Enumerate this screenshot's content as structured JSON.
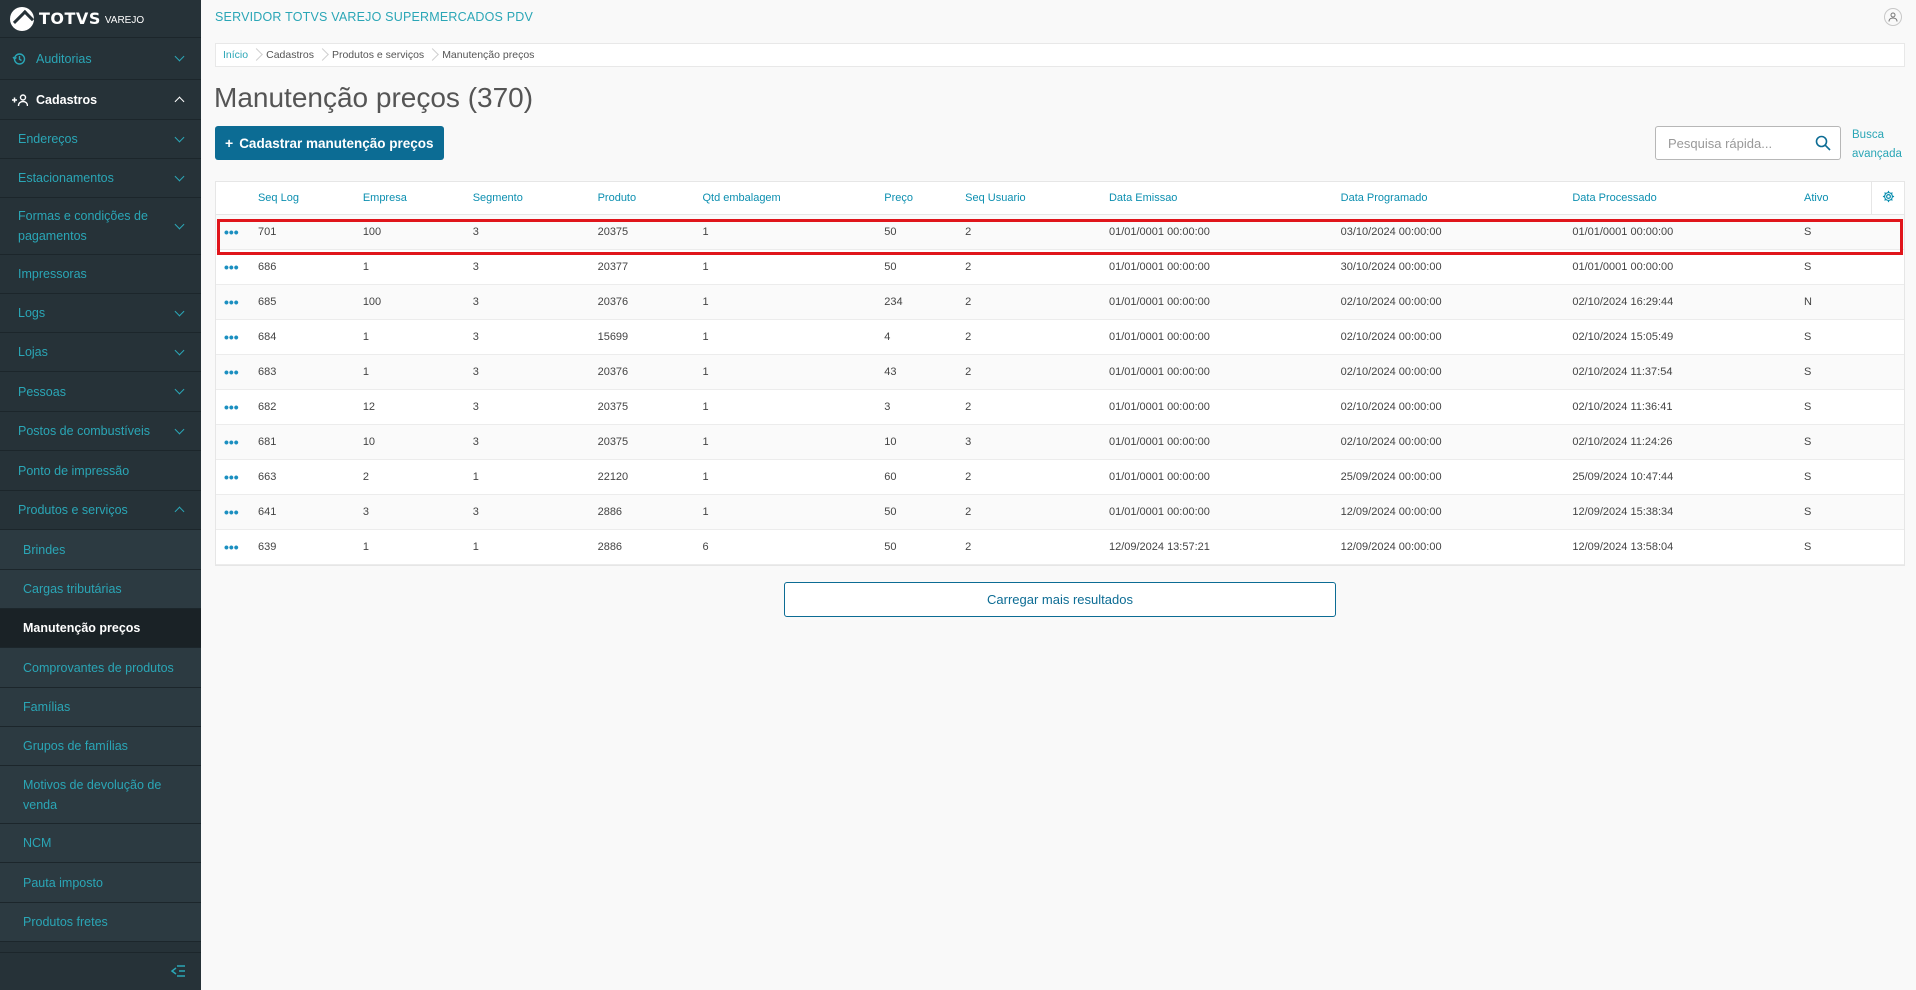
{
  "app": {
    "logo_text": "TOTVS",
    "logo_sub": "VAREJO",
    "server_title": "SERVIDOR TOTVS VAREJO SUPERMERCADOS PDV"
  },
  "sidebar": {
    "auditorias": "Auditorias",
    "cadastros": "Cadastros",
    "enderecos": "Endereços",
    "estacionamentos": "Estacionamentos",
    "formas": "Formas e condições de pagamentos",
    "impressoras": "Impressoras",
    "logs": "Logs",
    "lojas": "Lojas",
    "pessoas": "Pessoas",
    "postos": "Postos de combustíveis",
    "ponto": "Ponto de impressão",
    "produtos": "Produtos e serviços",
    "brindes": "Brindes",
    "cargas": "Cargas tributárias",
    "manutencao": "Manutenção preços",
    "comprovantes": "Comprovantes de produtos",
    "familias": "Famílias",
    "grupos": "Grupos de famílias",
    "motivos": "Motivos de devolução de venda",
    "ncm": "NCM",
    "pauta": "Pauta imposto",
    "fretes": "Produtos fretes"
  },
  "breadcrumb": {
    "inicio": "Início",
    "cadastros": "Cadastros",
    "produtos": "Produtos e serviços",
    "current": "Manutenção preços"
  },
  "page": {
    "title": "Manutenção preços (370)",
    "add_button": "Cadastrar manutenção preços",
    "search_placeholder": "Pesquisa rápida...",
    "advanced_search": "Busca avançada",
    "load_more": "Carregar mais resultados"
  },
  "table": {
    "headers": {
      "seq_log": "Seq Log",
      "empresa": "Empresa",
      "segmento": "Segmento",
      "produto": "Produto",
      "qtd": "Qtd embalagem",
      "preco": "Preço",
      "seq_usuario": "Seq Usuario",
      "data_emissao": "Data Emissao",
      "data_programado": "Data Programado",
      "data_processado": "Data Processado",
      "ativo": "Ativo"
    },
    "rows": [
      {
        "seq": "701",
        "empresa": "100",
        "segmento": "3",
        "produto": "20375",
        "qtd": "1",
        "preco": "50",
        "usuario": "2",
        "emissao": "01/01/0001 00:00:00",
        "programado": "03/10/2024 00:00:00",
        "processado": "01/01/0001 00:00:00",
        "ativo": "S"
      },
      {
        "seq": "686",
        "empresa": "1",
        "segmento": "3",
        "produto": "20377",
        "qtd": "1",
        "preco": "50",
        "usuario": "2",
        "emissao": "01/01/0001 00:00:00",
        "programado": "30/10/2024 00:00:00",
        "processado": "01/01/0001 00:00:00",
        "ativo": "S"
      },
      {
        "seq": "685",
        "empresa": "100",
        "segmento": "3",
        "produto": "20376",
        "qtd": "1",
        "preco": "234",
        "usuario": "2",
        "emissao": "01/01/0001 00:00:00",
        "programado": "02/10/2024 00:00:00",
        "processado": "02/10/2024 16:29:44",
        "ativo": "N"
      },
      {
        "seq": "684",
        "empresa": "1",
        "segmento": "3",
        "produto": "15699",
        "qtd": "1",
        "preco": "4",
        "usuario": "2",
        "emissao": "01/01/0001 00:00:00",
        "programado": "02/10/2024 00:00:00",
        "processado": "02/10/2024 15:05:49",
        "ativo": "S"
      },
      {
        "seq": "683",
        "empresa": "1",
        "segmento": "3",
        "produto": "20376",
        "qtd": "1",
        "preco": "43",
        "usuario": "2",
        "emissao": "01/01/0001 00:00:00",
        "programado": "02/10/2024 00:00:00",
        "processado": "02/10/2024 11:37:54",
        "ativo": "S"
      },
      {
        "seq": "682",
        "empresa": "12",
        "segmento": "3",
        "produto": "20375",
        "qtd": "1",
        "preco": "3",
        "usuario": "2",
        "emissao": "01/01/0001 00:00:00",
        "programado": "02/10/2024 00:00:00",
        "processado": "02/10/2024 11:36:41",
        "ativo": "S"
      },
      {
        "seq": "681",
        "empresa": "10",
        "segmento": "3",
        "produto": "20375",
        "qtd": "1",
        "preco": "10",
        "usuario": "3",
        "emissao": "01/01/0001 00:00:00",
        "programado": "02/10/2024 00:00:00",
        "processado": "02/10/2024 11:24:26",
        "ativo": "S"
      },
      {
        "seq": "663",
        "empresa": "2",
        "segmento": "1",
        "produto": "22120",
        "qtd": "1",
        "preco": "60",
        "usuario": "2",
        "emissao": "01/01/0001 00:00:00",
        "programado": "25/09/2024 00:00:00",
        "processado": "25/09/2024 10:47:44",
        "ativo": "S"
      },
      {
        "seq": "641",
        "empresa": "3",
        "segmento": "3",
        "produto": "2886",
        "qtd": "1",
        "preco": "50",
        "usuario": "2",
        "emissao": "01/01/0001 00:00:00",
        "programado": "12/09/2024 00:00:00",
        "processado": "12/09/2024 15:38:34",
        "ativo": "S"
      },
      {
        "seq": "639",
        "empresa": "1",
        "segmento": "1",
        "produto": "2886",
        "qtd": "6",
        "preco": "50",
        "usuario": "2",
        "emissao": "12/09/2024 13:57:21",
        "programado": "12/09/2024 00:00:00",
        "processado": "12/09/2024 13:58:04",
        "ativo": "S"
      }
    ]
  },
  "colors": {
    "sidebar_bg": "#263238",
    "accent": "#2aa6b6",
    "primary": "#0c6c94",
    "highlight": "#e0151b"
  }
}
